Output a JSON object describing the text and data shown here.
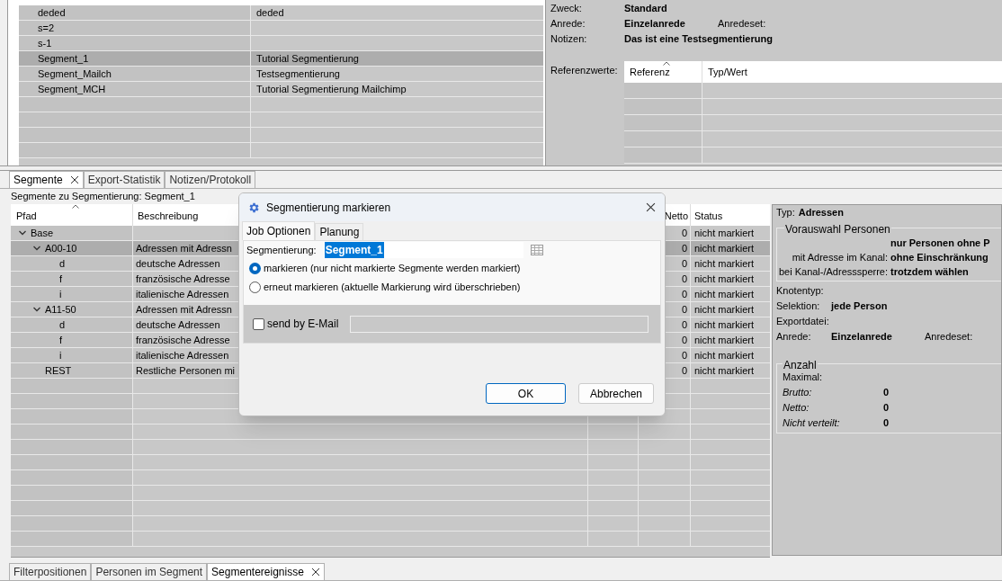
{
  "top_table": {
    "rows": [
      {
        "column_1": "deded",
        "column_2": "deded",
        "selected": false
      },
      {
        "column_1": "s=2",
        "selected": false
      },
      {
        "column_1": "s-1",
        "selected": false
      },
      {
        "column_1": "Segment_1",
        "column_2": "Tutorial Segmentierung",
        "selected": true
      },
      {
        "column_1": "Segment_Mailch",
        "column_2": "Testsegmentierung",
        "selected": false
      },
      {
        "column_1": "Segment_MCH",
        "column_2": "Tutorial Segmentierung Mailchimp",
        "selected": false
      }
    ]
  },
  "details": {
    "fields": [
      {
        "label": "Zweck:",
        "value": "Standard"
      },
      {
        "label": "Anrede:",
        "value": "Einzelanrede",
        "extra_label": "Anredeset:"
      },
      {
        "label": "Notizen:",
        "value": "Das ist eine Testsegmentierung"
      }
    ],
    "reference_label": "Referenzwerte:",
    "reference_columns": [
      "Referenz",
      "Typ/Wert"
    ]
  },
  "tabs": [
    {
      "label": "Segmente",
      "selected": true,
      "closable": true
    },
    {
      "label": "Export-Statistik",
      "selected": false,
      "closable": false
    },
    {
      "label": "Notizen/Protokoll",
      "selected": false,
      "closable": false
    }
  ],
  "segments": {
    "caption": "Segmente zu Segmentierung: Segment_1",
    "columns": [
      "Pfad",
      "Beschreibung",
      "Netto",
      "Status"
    ],
    "rows": [
      {
        "path": "Base",
        "netto": "0",
        "status": "nicht markiert",
        "selected": false,
        "expanded": true,
        "children": [
          {
            "path": "A00-10",
            "description": "Adressen mit Adressn",
            "netto": "0",
            "status": "nicht markiert",
            "selected": true,
            "expanded": true,
            "children": [
              {
                "path": "d",
                "description": "deutsche Adressen",
                "netto": "0",
                "status": "nicht markiert",
                "selected": false
              },
              {
                "path": "f",
                "description": "französische Adresse",
                "netto": "0",
                "status": "nicht markiert",
                "selected": false
              },
              {
                "path": "i",
                "description": "italienische Adressen",
                "netto": "0",
                "status": "nicht markiert",
                "selected": false
              }
            ]
          },
          {
            "path": "A11-50",
            "description": "Adressen mit Adressn",
            "netto": "0",
            "status": "nicht markiert",
            "selected": false,
            "expanded": true,
            "children": [
              {
                "path": "d",
                "description": "deutsche Adressen",
                "netto": "0",
                "status": "nicht markiert",
                "selected": false
              },
              {
                "path": "f",
                "description": "französische Adresse",
                "netto": "0",
                "status": "nicht markiert",
                "selected": false
              },
              {
                "path": "i",
                "description": "italienische Adressen",
                "netto": "0",
                "status": "nicht markiert",
                "selected": false
              }
            ]
          },
          {
            "path": "REST",
            "description": "Restliche Personen mi",
            "netto": "0",
            "status": "nicht markiert",
            "selected": false
          }
        ]
      }
    ]
  },
  "node_details": {
    "type_label": "Typ:",
    "type_value": "Adressen",
    "preselection": {
      "title": "Vorauswahl Personen",
      "rows": [
        {
          "value": "nur Personen ohne P"
        },
        {
          "label": "mit Adresse im Kanal:",
          "value": "ohne Einschränkung"
        },
        {
          "label": "bei Kanal-/Adresssperre:",
          "value": "trotzdem wählen"
        }
      ]
    },
    "fields": [
      {
        "label": "Knotentyp:"
      },
      {
        "label": "Selektion:",
        "value": "jede Person"
      },
      {
        "label": "Exportdatei:"
      },
      {
        "label": "Anrede:",
        "value": "Einzelanrede",
        "extra_label": "Anredeset:"
      }
    ],
    "count": {
      "title": "Anzahl",
      "heading": "Maximal:",
      "rows": [
        {
          "label": "Brutto:",
          "value": "0"
        },
        {
          "label": "Netto:",
          "value": "0"
        },
        {
          "label": "Nicht verteilt:",
          "value": "0"
        }
      ]
    }
  },
  "dialog": {
    "title": "Segmentierung markieren",
    "tabs": [
      {
        "label": "Job Optionen",
        "selected": true
      },
      {
        "label": "Planung",
        "selected": false
      }
    ],
    "segment_label": "Segmentierung:",
    "segment_value": "Segment_1",
    "options": [
      {
        "label": "markieren (nur nicht markierte Segmente werden markiert)",
        "selected": true
      },
      {
        "label": "erneut markieren (aktuelle Markierung wird überschrieben)",
        "selected": false
      }
    ],
    "email": {
      "label": "send by E-Mail",
      "checked": false,
      "field_disabled": true
    },
    "buttons": [
      {
        "label": "OK",
        "primary": true
      },
      {
        "label": "Abbrechen",
        "primary": false
      }
    ]
  },
  "bottom_tabs": [
    {
      "label": "Filterpositionen",
      "selected": false,
      "closable": false
    },
    {
      "label": "Personen im Segment",
      "selected": false,
      "closable": false
    },
    {
      "label": "Segmentereignisse",
      "selected": true,
      "closable": true
    }
  ]
}
